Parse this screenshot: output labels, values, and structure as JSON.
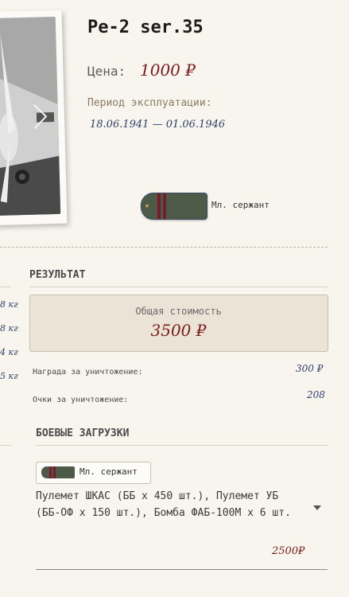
{
  "plane": {
    "title": "Pe-2 ser.35",
    "price_label": "Цена:",
    "price_value": "1000 ₽",
    "period_label": "Период эксплуатации:",
    "period_value": "18.06.1941 — 01.06.1946"
  },
  "rank": {
    "label": "Мл. сержант"
  },
  "left_column": {
    "weights": [
      "8 кг",
      "8 кг",
      "4 кг",
      "5 кг"
    ]
  },
  "result": {
    "heading": "РЕЗУЛЬТАТ",
    "total_label": "Общая стоимость",
    "total_value": "3500 ₽",
    "kill_reward_label": "Награда за уничтожение:",
    "kill_reward_value": "300 ₽",
    "kill_points_label": "Очки за уничтожение:",
    "kill_points_value": "208"
  },
  "loadouts": {
    "heading": "БОЕВЫЕ ЗАГРУЗКИ",
    "rank_chip_label": "Мл. сержант",
    "selected_loadout": "Пулемет ШКАС (ББ x 450 шт.), Пулемет УБ (ББ-ОФ x 150 шт.), Бомба ФАБ-100М x 6 шт.",
    "price": "2500₽"
  },
  "colors": {
    "accent_red": "#7a1b1b",
    "ink_blue": "#2f3f6b",
    "background": "#f8f5ee",
    "box_background": "#ece3d7"
  }
}
